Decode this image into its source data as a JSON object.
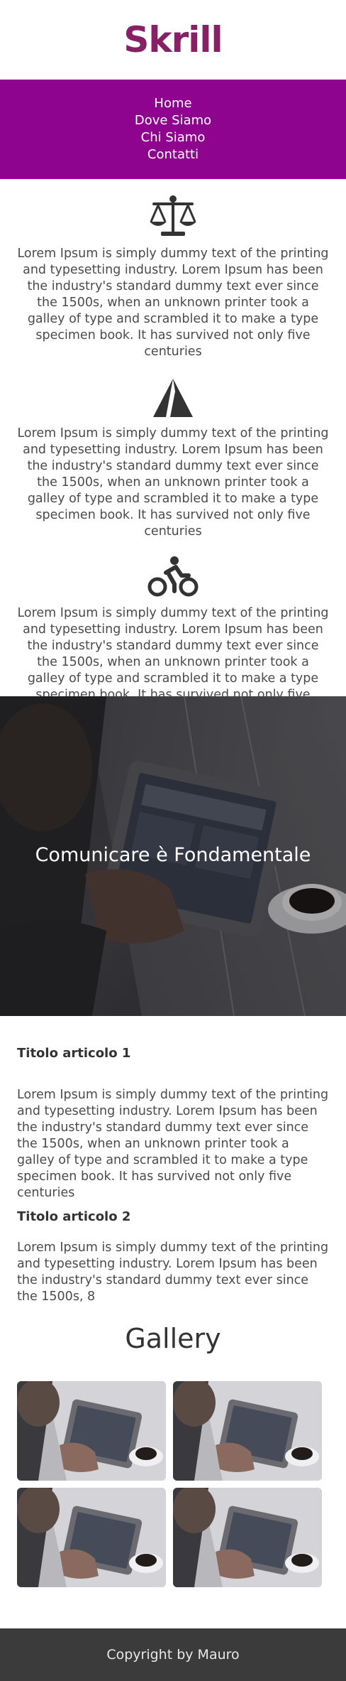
{
  "brand": {
    "logo_text": "Skrill"
  },
  "nav": {
    "items": [
      "Home",
      "Dove Siamo",
      "Chi Siamo",
      "Contatti"
    ]
  },
  "features": [
    {
      "icon": "balance-scale-icon",
      "text": "Lorem Ipsum is simply dummy text of the printing and typesetting industry. Lorem Ipsum has been the industry's standard dummy text ever since the 1500s, when an unknown printer took a galley of type and scrambled it to make a type specimen book. It has survived not only five centuries"
    },
    {
      "icon": "mountain-icon",
      "text": "Lorem Ipsum is simply dummy text of the printing and typesetting industry. Lorem Ipsum has been the industry's standard dummy text ever since the 1500s, when an unknown printer took a galley of type and scrambled it to make a type specimen book. It has survived not only five centuries"
    },
    {
      "icon": "cyclist-icon",
      "text": "Lorem Ipsum is simply dummy text of the printing and typesetting industry. Lorem Ipsum has been the industry's standard dummy text ever since the 1500s, when an unknown printer took a galley of type and scrambled it to make a type specimen book. It has survived not only five centuries"
    }
  ],
  "hero": {
    "title": "Comunicare è Fondamentale"
  },
  "articles": [
    {
      "title": "Titolo articolo 1",
      "body": "Lorem Ipsum is simply dummy text of the printing and typesetting industry. Lorem Ipsum has been the industry's standard dummy text ever since the 1500s, when an unknown printer took a galley of type and scrambled it to make a type specimen book. It has survived not only five centuries"
    },
    {
      "title": "Titolo articolo 2",
      "body": "Lorem Ipsum is simply dummy text of the printing and typesetting industry. Lorem Ipsum has been the industry's standard dummy text ever since the 1500s, 8"
    }
  ],
  "gallery": {
    "title": "Gallery"
  },
  "footer": {
    "text": "Copyright by Mauro"
  },
  "colors": {
    "brand": "#862165",
    "nav_bg": "#8e048e",
    "footer_bg": "#3b3b3b"
  }
}
